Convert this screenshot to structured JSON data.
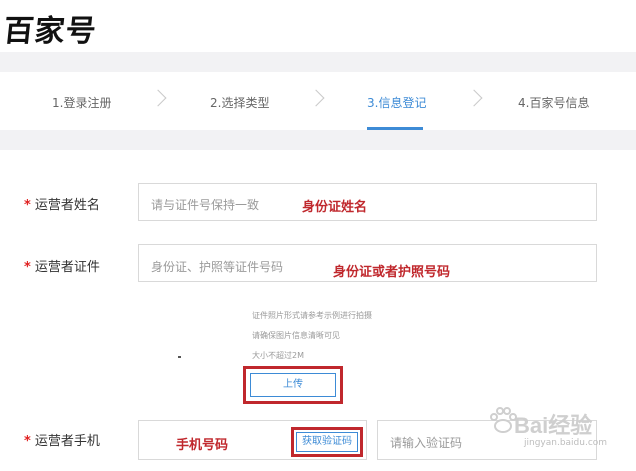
{
  "header": {
    "logo_text": "百家号"
  },
  "steps": [
    {
      "label": "1.登录注册"
    },
    {
      "label": "2.选择类型"
    },
    {
      "label": "3.信息登记"
    },
    {
      "label": "4.百家号信息"
    }
  ],
  "form": {
    "required_mark": "*",
    "name_field": {
      "label": "运营者姓名",
      "placeholder": "请与证件号保持一致",
      "annotation": "身份证姓名"
    },
    "id_field": {
      "label": "运营者证件",
      "placeholder": "身份证、护照等证件号码",
      "annotation": "身份证或者护照号码",
      "hints": [
        "证件照片形式请参考示例进行拍摄",
        "请确保图片信息清晰可见",
        "大小不超过2M"
      ],
      "upload_label": "上传"
    },
    "phone_field": {
      "label": "运营者手机",
      "annotation": "手机号码",
      "get_code_label": "获取验证码",
      "code_placeholder": "请输入验证码"
    }
  },
  "watermark": {
    "text": "Bai经验",
    "url": "jingyan.baidu.com"
  },
  "colors": {
    "accent": "#3d8bd6",
    "annotation_red": "#c0282d",
    "required_red": "#e02020"
  }
}
